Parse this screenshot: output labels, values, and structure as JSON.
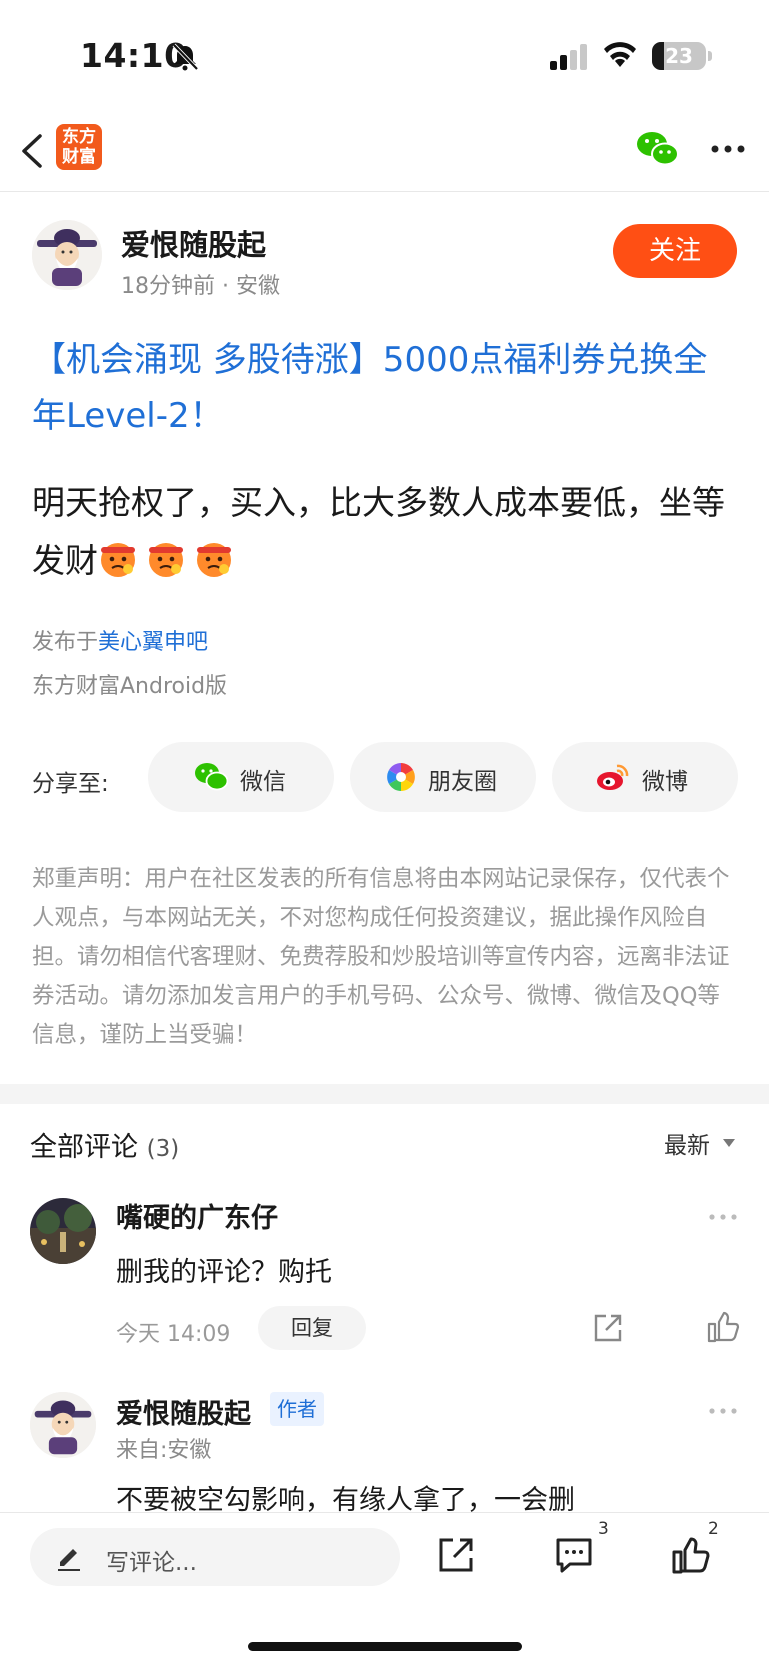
{
  "status_bar": {
    "time": "14:10",
    "battery": "23",
    "battery_level": 0.23
  },
  "nav": {
    "logo_line1": "东方",
    "logo_line2": "财富",
    "icons": [
      "back-icon",
      "wechat-icon",
      "more-icon"
    ]
  },
  "author": {
    "name": "爱恨随股起",
    "meta": "18分钟前 · 安徽",
    "follow_label": "关注"
  },
  "post": {
    "title": "【机会涌现 多股待涨】5000点福利券兑换全年Level-2！",
    "body": "明天抢权了，买入，比大多数人成本要低，坐等发财",
    "source_prefix": "发布于",
    "source_bar": "美心翼申吧",
    "client": "东方财富Android版"
  },
  "share": {
    "label": "分享至:",
    "wechat": "微信",
    "moments": "朋友圈",
    "weibo": "微博"
  },
  "disclaimer": "郑重声明：用户在社区发表的所有信息将由本网站记录保存，仅代表个人观点，与本网站无关，不对您构成任何投资建议，据此操作风险自担。请勿相信代客理财、免费荐股和炒股培训等宣传内容，远离非法证券活动。请勿添加发言用户的手机号码、公众号、微博、微信及QQ等信息，谨防上当受骗！",
  "comments": {
    "title": "全部评论",
    "count": "(3)",
    "sort": "最新",
    "items": [
      {
        "name": "嘴硬的广东仔",
        "text": "删我的评论？购托",
        "time": "今天 14:09",
        "reply": "回复"
      },
      {
        "name": "爱恨随股起",
        "tag": "作者",
        "from": "来自:安徽",
        "text": "不要被空勾影响，有缘人拿了，一会删"
      }
    ]
  },
  "bottom_bar": {
    "placeholder": "写评论...",
    "comment_count": "3",
    "like_count": "2"
  },
  "colors": {
    "accent": "#ff4f14",
    "link": "#1f6fd6",
    "brand": "#f25a1c"
  }
}
